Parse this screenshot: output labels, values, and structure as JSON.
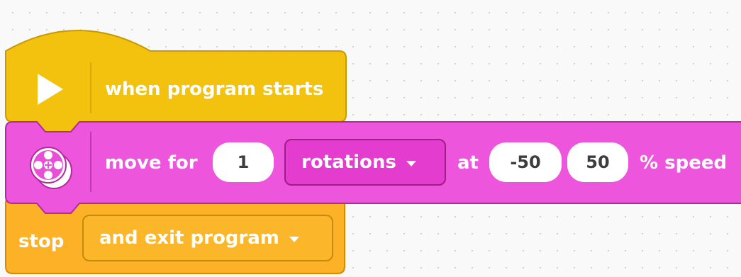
{
  "colors": {
    "events_block": "#f2c20f",
    "events_border": "#c99b00",
    "motor_block": "#ec55dc",
    "motor_border": "#b22a9e",
    "control_block": "#fdb126",
    "control_border": "#d58b00",
    "canvas_background": "#f9f9f9"
  },
  "hat_block": {
    "label": "when program starts",
    "icon": "play-triangle-icon"
  },
  "move_block": {
    "label_move_for": "move for",
    "amount": "1",
    "unit": "rotations",
    "label_at": "at",
    "speed_left": "-50",
    "speed_right": "50",
    "label_speed": "% speed",
    "icon": "motor-pair-icon"
  },
  "stop_block": {
    "label_stop": "stop",
    "option": "and exit program"
  }
}
